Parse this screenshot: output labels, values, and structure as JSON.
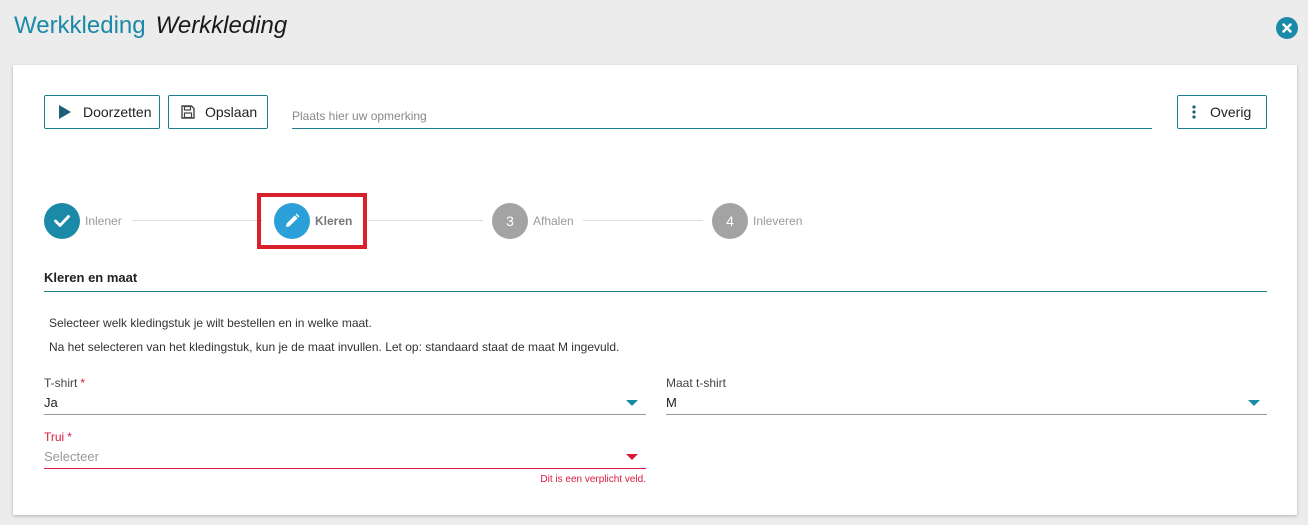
{
  "header": {
    "app_title": "Werkkleding",
    "page_title": "Werkkleding"
  },
  "toolbar": {
    "doorzetten_label": "Doorzetten",
    "opslaan_label": "Opslaan",
    "remark_placeholder": "Plaats hier uw opmerking",
    "overig_label": "Overig"
  },
  "stepper": {
    "steps": [
      {
        "label": "Inlener",
        "state": "completed",
        "icon": "check-icon"
      },
      {
        "label": "Kleren",
        "state": "active",
        "icon": "pencil-icon"
      },
      {
        "number": "3",
        "label": "Afhalen",
        "state": "pending"
      },
      {
        "number": "4",
        "label": "Inleveren",
        "state": "pending"
      }
    ]
  },
  "section": {
    "title": "Kleren en maat",
    "info1": "Selecteer welk kledingstuk je wilt bestellen en in welke maat.",
    "info2": "Na het selecteren van het kledingstuk, kun je de maat invullen. Let op: standaard staat de maat M ingevuld."
  },
  "fields": {
    "tshirt": {
      "label": "T-shirt",
      "required_mark": "*",
      "value": "Ja"
    },
    "maat_tshirt": {
      "label": "Maat t-shirt",
      "value": "M"
    },
    "trui": {
      "label": "Trui",
      "required_mark": "*",
      "placeholder": "Selecteer",
      "error": "Dit is een verplicht veld."
    }
  },
  "colors": {
    "accent": "#1b8aa8",
    "active_step": "#2b9fd8",
    "error": "#d81b3c",
    "highlight": "#d9212d"
  }
}
